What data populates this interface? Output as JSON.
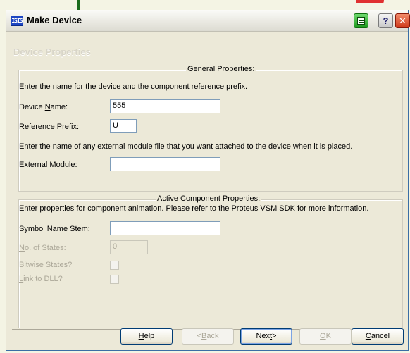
{
  "window": {
    "title": "Make Device",
    "app_icon_text": "ISIS"
  },
  "page": {
    "heading": "Device Properties"
  },
  "general": {
    "title": "General Properties:",
    "intro": "Enter the name for the device and the component reference prefix.",
    "device_name": {
      "label_pre": "Device ",
      "label_key": "N",
      "label_post": "ame:",
      "value": "555"
    },
    "reference_prefix": {
      "label_pre": "Reference Pre",
      "label_key": "f",
      "label_post": "ix:",
      "value": "U"
    },
    "module_intro": "Enter the name of any external module file that you want attached to the device when it is placed.",
    "external_module": {
      "label_pre": "External ",
      "label_key": "M",
      "label_post": "odule:",
      "value": ""
    }
  },
  "active": {
    "title": "Active Component Properties:",
    "intro": "Enter properties for component animation. Please refer to the Proteus VSM SDK for more information.",
    "symbol_name_stem": {
      "label": "Symbol Name Stem:",
      "value": ""
    },
    "no_of_states": {
      "label_key": "N",
      "label_post": "o. of States:",
      "value": "0"
    },
    "bitwise_states": {
      "label_key": "B",
      "label_post": "itwise States?",
      "checked": false
    },
    "link_to_dll": {
      "label_key": "L",
      "label_post": "ink to DLL?",
      "checked": false
    }
  },
  "buttons": {
    "help": {
      "key": "H",
      "rest": "elp"
    },
    "back": {
      "pre": "<",
      "key": "B",
      "rest": "ack"
    },
    "next": {
      "pre": "Nex",
      "key": "t",
      "rest": ">"
    },
    "ok": {
      "key": "O",
      "rest": "K"
    },
    "cancel": {
      "key": "C",
      "rest": "ancel"
    }
  }
}
